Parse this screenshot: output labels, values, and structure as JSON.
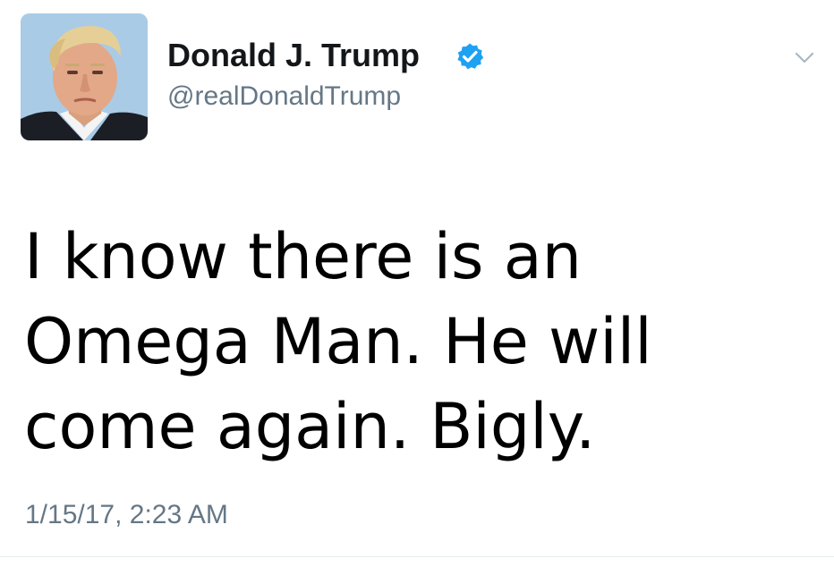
{
  "tweet": {
    "author": {
      "display_name": "Donald J. Trump",
      "handle": "@realDonaldTrump",
      "verified": true,
      "avatar_icon": "profile-photo"
    },
    "text": "I know there is an\nOmega Man. He will\ncome again. Bigly.",
    "timestamp": "1/15/17, 2:23 AM",
    "menu_icon": "chevron-down-icon"
  },
  "colors": {
    "verified_badge": "#1da1f2",
    "secondary_text": "#657786",
    "primary_text": "#14171a",
    "body_text": "#000000"
  }
}
